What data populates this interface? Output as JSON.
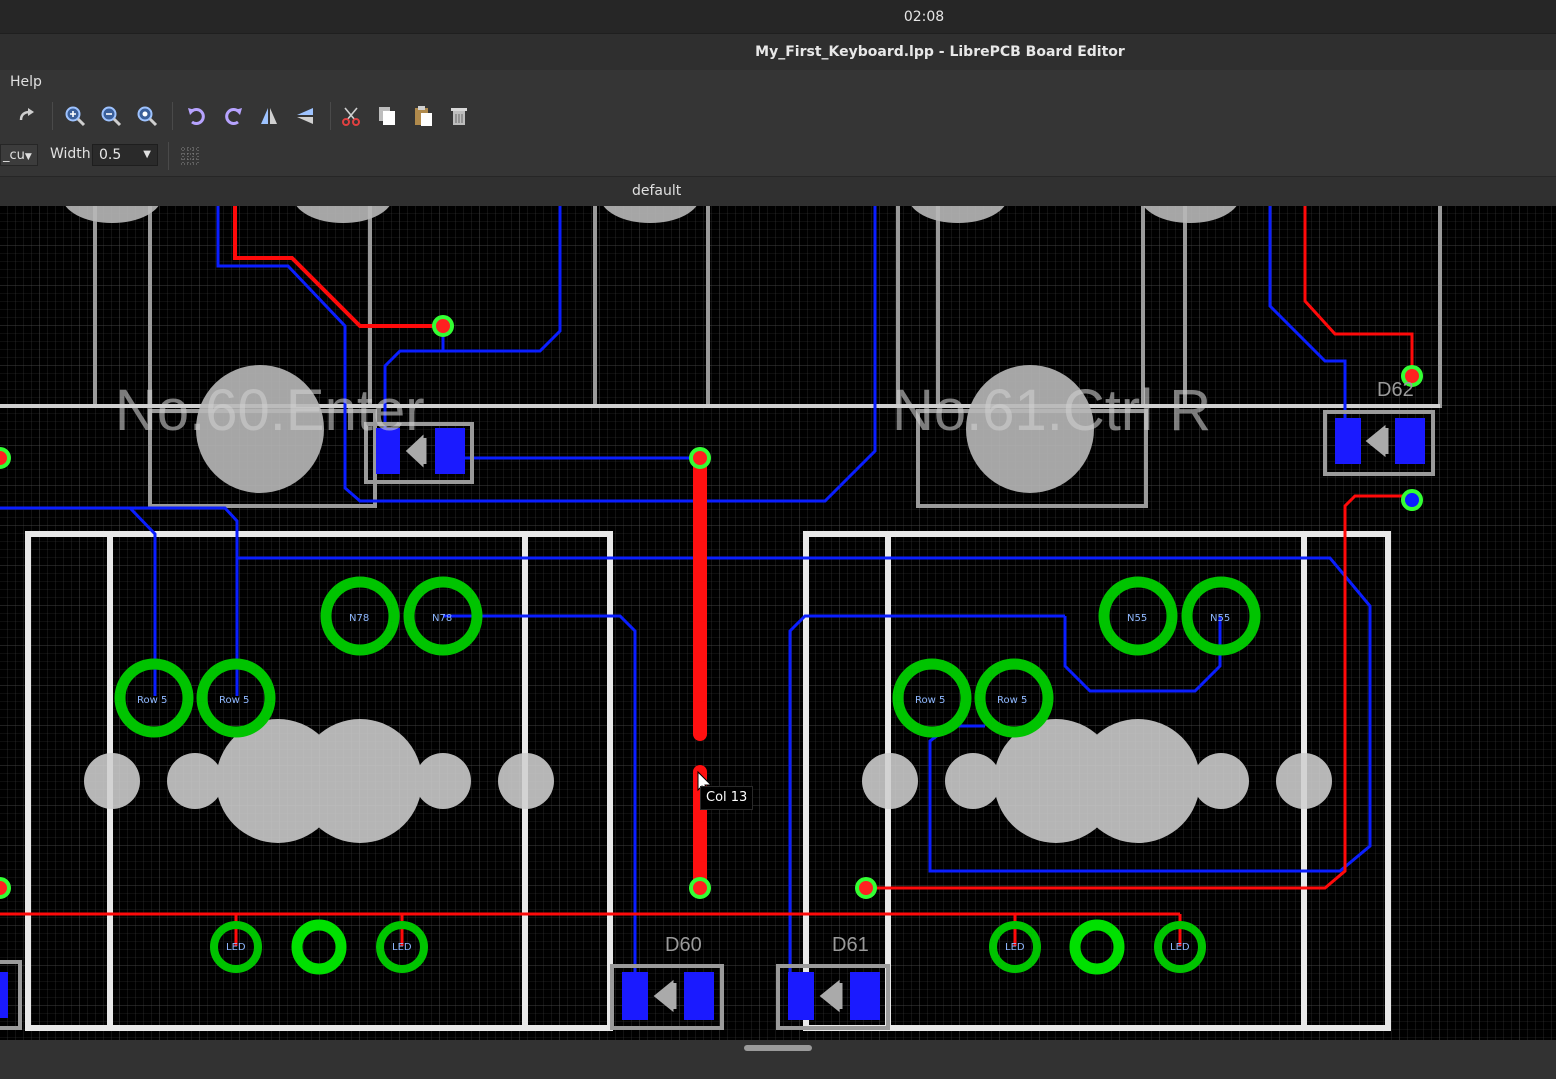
{
  "topbar": {
    "clock": "02:08"
  },
  "window": {
    "title": "My_First_Keyboard.lpp - LibrePCB Board Editor"
  },
  "menu": {
    "items": [
      "Help"
    ]
  },
  "toolbar": {
    "buttons": [
      "redo-icon",
      "zoom-in-icon",
      "zoom-out-icon",
      "zoom-fit-icon",
      "rotate-ccw-icon",
      "rotate-cw-icon",
      "mirror-icon",
      "flip-icon",
      "cut-icon",
      "copy-icon",
      "paste-icon",
      "delete-icon"
    ]
  },
  "props": {
    "layer_value": "_cu",
    "width_label": "Width:",
    "width_value": "0.5"
  },
  "tabs": {
    "active": "default"
  },
  "board": {
    "footprint_labels": [
      "No.60.Enter",
      "No.61.Ctrl R"
    ],
    "device_labels": [
      "D62",
      "D60",
      "D61"
    ],
    "pad_labels": {
      "n78": "N78",
      "n55": "N55",
      "row5": "Row 5",
      "led": "LED"
    },
    "colors": {
      "background": "#000000",
      "top_copper": "#ff0000",
      "bottom_copper": "#0000ff",
      "pads": "#00c800",
      "outline": "#ffffff"
    }
  },
  "tooltip": {
    "text": "Col 13"
  }
}
